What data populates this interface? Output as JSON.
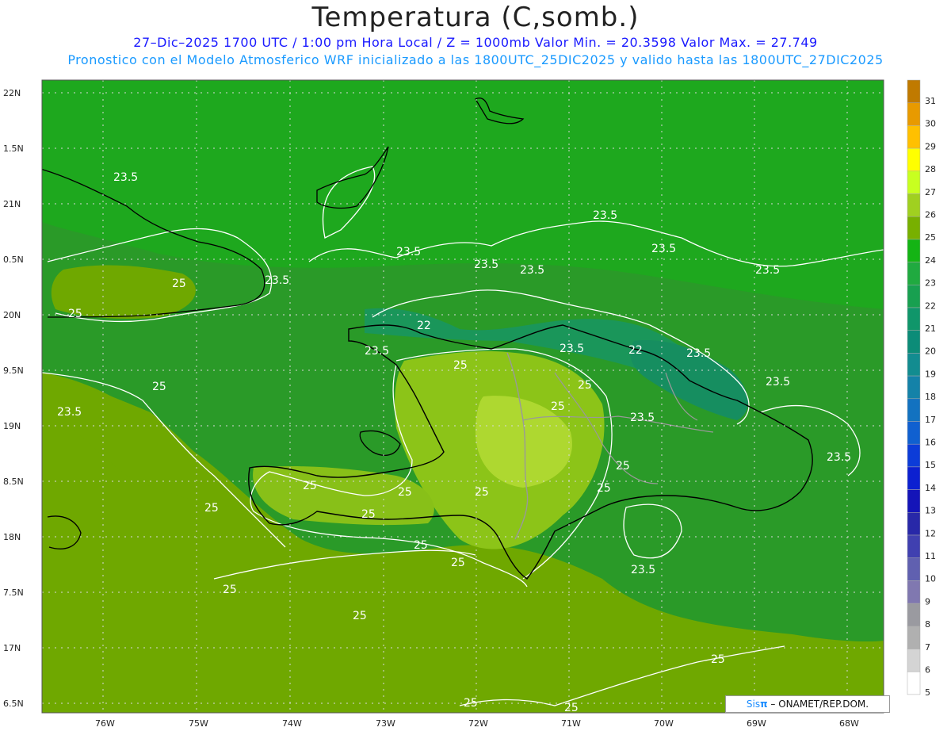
{
  "header": {
    "title": "Temperatura (C,somb.)",
    "subtitle": "27–Dic–2025  1700 UTC / 1:00 pm Hora Local / Z = 1000mb    Valor Min. = 20.3598  Valor Max. = 27.749",
    "subtitle2": "Pronostico con el Modelo Atmosferico WRF inicializado a las 1800UTC_25DIC2025 y valido hasta las  1800UTC_27DIC2025"
  },
  "axes": {
    "lat_labels": [
      "22N",
      "1.5N",
      "21N",
      "0.5N",
      "20N",
      "9.5N",
      "19N",
      "8.5N",
      "18N",
      "7.5N",
      "17N",
      "6.5N"
    ],
    "lon_labels": [
      "76W",
      "75W",
      "74W",
      "73W",
      "72W",
      "71W",
      "70W",
      "69W",
      "68W"
    ]
  },
  "colorbar": {
    "levels": [
      "31",
      "30",
      "29",
      "28",
      "27",
      "26",
      "25",
      "24",
      "23",
      "22",
      "21",
      "20",
      "19",
      "18",
      "17",
      "16",
      "15",
      "14",
      "13",
      "12",
      "11",
      "10",
      "9",
      "8",
      "7",
      "6",
      "5"
    ],
    "colors": [
      "#c07a00",
      "#e89a00",
      "#ffc000",
      "#ffff00",
      "#c8ff20",
      "#a0d020",
      "#78b000",
      "#14b414",
      "#20aa40",
      "#18a050",
      "#10966a",
      "#0c8c78",
      "#128c90",
      "#1482a8",
      "#1272c0",
      "#1060d0",
      "#0c3cd8",
      "#0c20d0",
      "#1414b8",
      "#2828a8",
      "#4040b0",
      "#6060b0",
      "#8078b0",
      "#9a9aa0",
      "#b0b0b0",
      "#d4d4d4",
      "#ffffff"
    ]
  },
  "contour_labels": {
    "c25": "25",
    "c235": "23.5",
    "c22": "22"
  },
  "credit": {
    "brand": "Sis",
    "pi": "π",
    "text": " – ONAMET/REP.DOM."
  }
}
